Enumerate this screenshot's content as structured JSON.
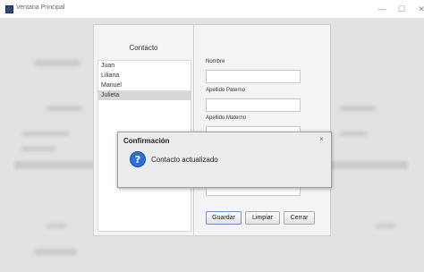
{
  "window": {
    "title": "Ventana Principal",
    "controls": {
      "minimize": "—",
      "maximize": "☐",
      "close": "✕"
    }
  },
  "contacts": {
    "heading": "Contacto",
    "items": [
      {
        "label": "Juan",
        "selected": false
      },
      {
        "label": "Liliana",
        "selected": false
      },
      {
        "label": "Manuel",
        "selected": false
      },
      {
        "label": "Julieta",
        "selected": true
      }
    ]
  },
  "form": {
    "nombre_label": "Nombre",
    "nombre_value": "",
    "apellido_paterno_label": "Apellido Paterno",
    "apellido_paterno_value": "",
    "apellido_materno_label": "Apellido Materno",
    "apellido_materno_value": "",
    "buttons": {
      "save": "Guardar",
      "clear": "Limpiar",
      "close": "Cerrar"
    }
  },
  "dialog": {
    "title": "Confirmación",
    "message": "Contacto actualizado",
    "close": "×",
    "icon": "question-icon"
  },
  "colors": {
    "dialog_icon": "#2e6fd8",
    "selected_row": "#d8d8d8",
    "primary_button_border": "#6b8fcf"
  }
}
